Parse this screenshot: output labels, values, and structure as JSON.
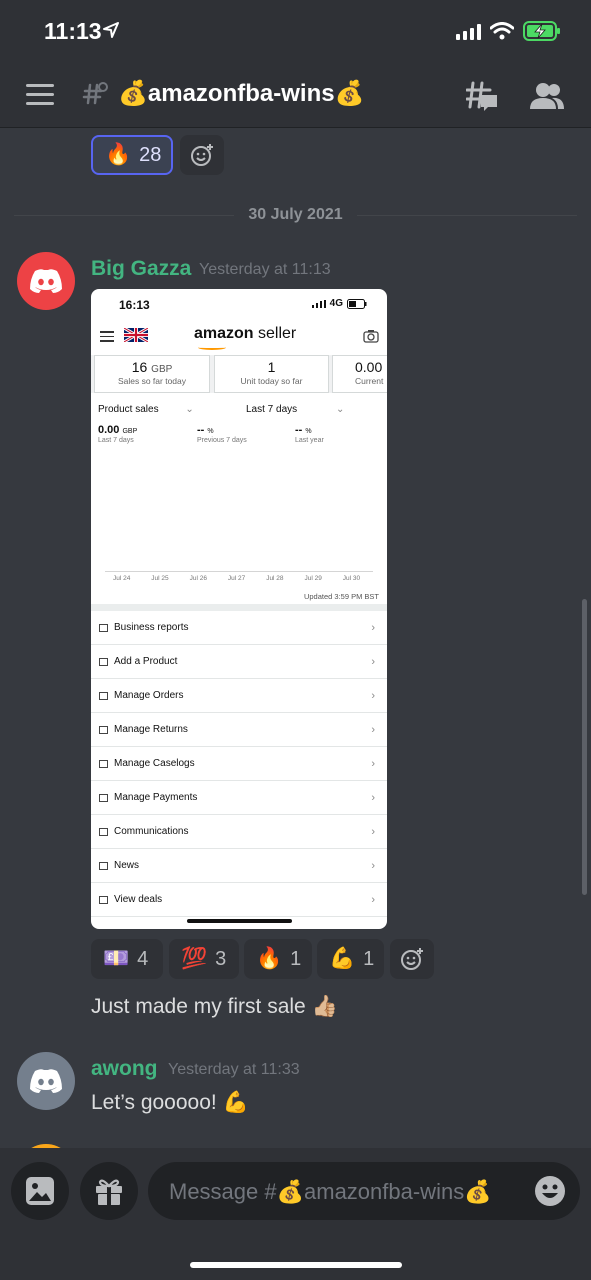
{
  "status_bar": {
    "time": "11:13"
  },
  "header": {
    "channel_name": "💰amazonfba-wins💰"
  },
  "reactions_top": [
    {
      "emoji": "🔥",
      "count": "28"
    }
  ],
  "date_divider": "30 July 2021",
  "messages": [
    {
      "username": "Big Gazza",
      "timestamp": "Yesterday at 11:13",
      "text": "Just made my first sale 👍🏼",
      "reactions": [
        {
          "emoji": "💷",
          "count": "4"
        },
        {
          "emoji": "💯",
          "count": "3"
        },
        {
          "emoji": "🔥",
          "count": "1"
        },
        {
          "emoji": "💪",
          "count": "1"
        }
      ]
    },
    {
      "username": "awong",
      "timestamp": "Yesterday at 11:33",
      "text": "Let’s gooooo! 💪"
    }
  ],
  "attachment": {
    "time": "16:13",
    "network": "4G",
    "logo_bold": "amazon",
    "logo_rest": " seller",
    "cards": [
      {
        "value": "16",
        "unit": "GBP",
        "label": "Sales so far today"
      },
      {
        "value": "1",
        "unit": "",
        "label": "Unit today so far"
      },
      {
        "value": "0.00",
        "unit": "",
        "label": "Current"
      }
    ],
    "filter_left": "Product sales",
    "filter_right": "Last 7 days",
    "metrics": [
      {
        "value": "0.00",
        "unit": "GBP",
        "label": "Last 7 days"
      },
      {
        "value": "--",
        "unit": "%",
        "label": "Previous 7 days"
      },
      {
        "value": "--",
        "unit": "%",
        "label": "Last year"
      }
    ],
    "chart_data": {
      "type": "line",
      "categories": [
        "Jul 24",
        "Jul 25",
        "Jul 26",
        "Jul 27",
        "Jul 28",
        "Jul 29",
        "Jul 30"
      ]
    },
    "updated": "Updated 3:59 PM BST",
    "menu": [
      "Business reports",
      "Add a Product",
      "Manage Orders",
      "Manage Returns",
      "Manage Caselogs",
      "Manage Payments",
      "Communications",
      "News",
      "View deals"
    ]
  },
  "input": {
    "placeholder": "Message #💰amazonfba-wins💰"
  },
  "colors": {
    "background": "#36393f",
    "username": "#43b581",
    "discord_red": "#ed4245",
    "blurple": "#5865f2"
  },
  "icons": [
    "location-arrow-icon",
    "signal-icon",
    "wifi-icon",
    "battery-charging-icon",
    "menu-icon",
    "hash-lock-icon",
    "threads-icon",
    "members-icon",
    "add-reaction-icon",
    "discord-avatar-icon",
    "image-icon",
    "gift-icon",
    "emoji-icon"
  ]
}
